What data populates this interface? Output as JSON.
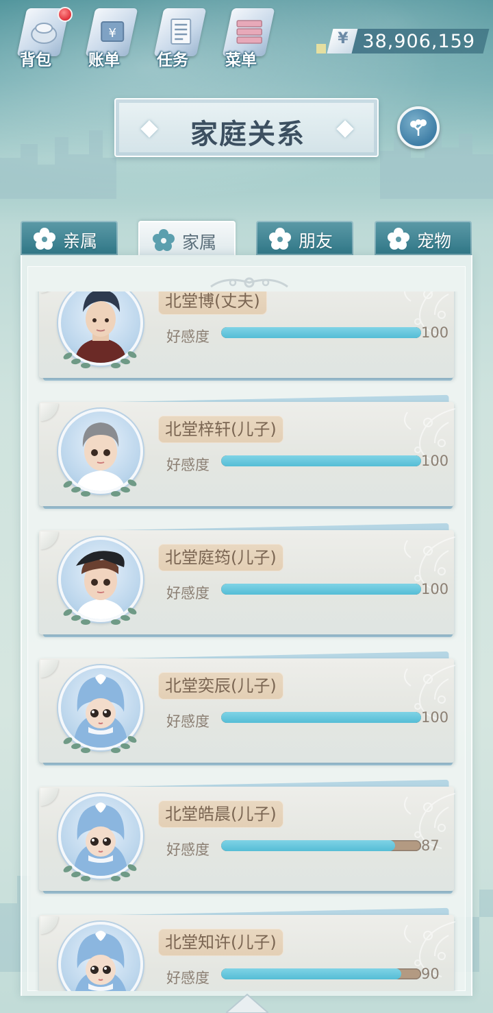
{
  "hud": {
    "buttons": [
      {
        "label": "背包",
        "icon": "backpack-icon",
        "has_notification": true
      },
      {
        "label": "账单",
        "icon": "bill-icon",
        "has_notification": false
      },
      {
        "label": "任务",
        "icon": "task-icon",
        "has_notification": false
      },
      {
        "label": "菜单",
        "icon": "menu-icon",
        "has_notification": false
      }
    ],
    "currency_symbol": "¥",
    "money": "38,906,159"
  },
  "title": "家庭关系",
  "family_tree_icon": "family-tree-icon",
  "tabs": [
    {
      "label": "亲属",
      "active": false
    },
    {
      "label": "家属",
      "active": true
    },
    {
      "label": "朋友",
      "active": false
    },
    {
      "label": "宠物",
      "active": false
    }
  ],
  "affinity_label": "好感度",
  "members": [
    {
      "name": "北堂博(丈夫)",
      "affinity": 100,
      "affinity_text": "100",
      "avatar": "husband-avatar"
    },
    {
      "name": "北堂梓轩(儿子)",
      "affinity": 100,
      "affinity_text": "100",
      "avatar": "son-gray-hair-avatar"
    },
    {
      "name": "北堂庭筠(儿子)",
      "affinity": 100,
      "affinity_text": "100",
      "avatar": "son-cap-avatar"
    },
    {
      "name": "北堂奕辰(儿子)",
      "affinity": 100,
      "affinity_text": "100",
      "avatar": "baby-dino-avatar"
    },
    {
      "name": "北堂皓晨(儿子)",
      "affinity": 87,
      "affinity_text": "87",
      "avatar": "baby-dino-avatar"
    },
    {
      "name": "北堂知许(儿子)",
      "affinity": 90,
      "affinity_text": "90",
      "avatar": "baby-dino-avatar"
    }
  ],
  "colors": {
    "affinity_fill": "#55bdd6",
    "affinity_track": "#b39a82",
    "name_plate": "#e6d4bb",
    "notification": "#e0303a"
  }
}
